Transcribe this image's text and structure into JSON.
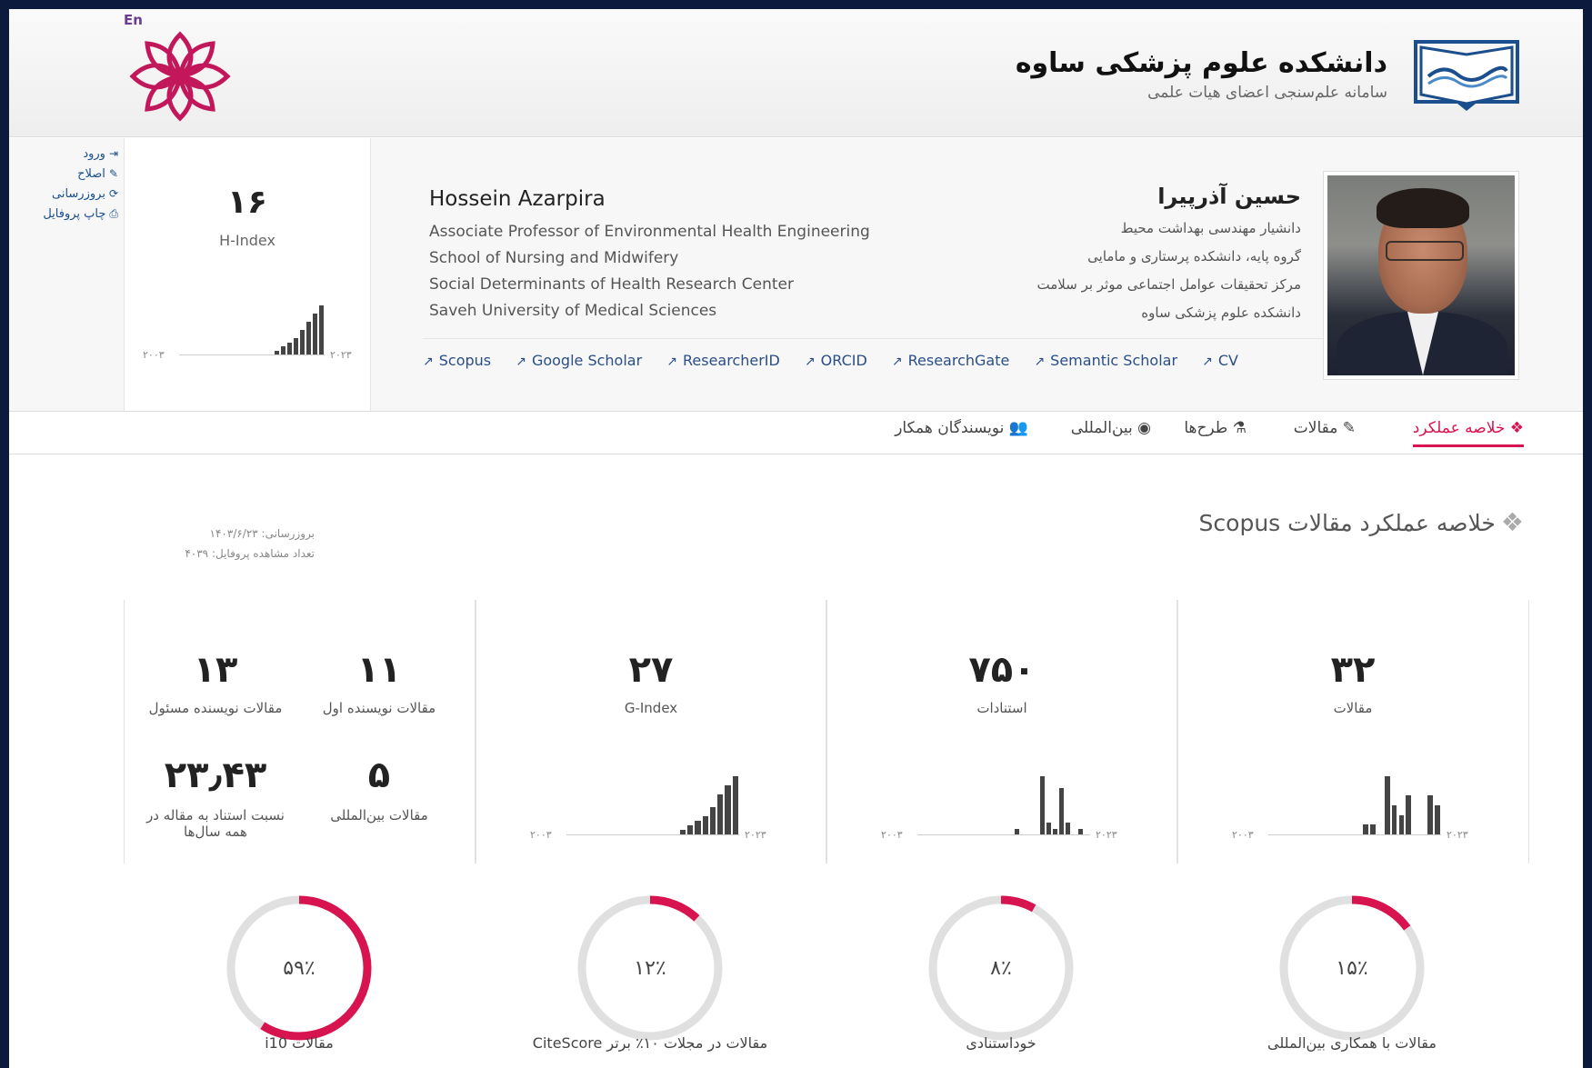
{
  "header": {
    "lang": "En",
    "uni_name": "دانشکده علوم پزشکی ساوه",
    "uni_sub": "سامانه علم‌سنجی اعضای هیات علمی"
  },
  "side_links": [
    "ورود",
    "اصلاح",
    "بروزرسانی",
    "چاپ پروفایل"
  ],
  "hindex": {
    "value": "۱۶",
    "label": "H-Index",
    "yr_start": "۲۰۰۳",
    "yr_end": "۲۰۲۳"
  },
  "profile": {
    "en_name": "Hossein Azarpira",
    "en_lines": [
      "Associate Professor of Environmental Health Engineering",
      "School of Nursing and Midwifery",
      "Social Determinants of Health Research Center",
      "Saveh University of Medical Sciences"
    ],
    "fa_name": "حسین آذرپیرا",
    "fa_lines": [
      "دانشیار مهندسی بهداشت محیط",
      "گروه پایه، دانشکده پرستاری و مامایی",
      "مرکز تحقیقات عوامل اجتماعی موثر بر سلامت",
      "دانشکده علوم پزشکی ساوه"
    ]
  },
  "ext_links": [
    "Scopus",
    "Google Scholar",
    "ResearcherID",
    "ORCID",
    "ResearchGate",
    "Semantic Scholar",
    "CV"
  ],
  "tabs": [
    "خلاصه عملکرد",
    "مقالات",
    "طرح‌ها",
    "بین‌المللی",
    "نویسندگان همکار"
  ],
  "section": {
    "title": "خلاصه عملکرد مقالات",
    "title_suffix": "Scopus",
    "updated": "بروزرسانی: ۱۴۰۳/۶/۲۳",
    "views": "تعداد مشاهده پروفایل: ۴۰۳۹"
  },
  "stats": {
    "articles": {
      "value": "۳۲",
      "label": "مقالات"
    },
    "citations": {
      "value": "۷۵۰",
      "label": "استنادات"
    },
    "gindex": {
      "value": "۲۷",
      "label": "G-Index"
    },
    "first_author": {
      "value": "۱۱",
      "label": "مقالات نویسنده اول"
    },
    "corresponding": {
      "value": "۱۳",
      "label": "مقالات نویسنده مسئول"
    },
    "international": {
      "value": "۵",
      "label": "مقالات بین‌المللی"
    },
    "ratio": {
      "value": "۲۳٫۴۳",
      "label": "نسبت استناد به مقاله در همه سال‌ها"
    },
    "yr_start": "۲۰۰۳",
    "yr_end": "۲۰۲۳"
  },
  "donuts": [
    {
      "pct_text": "۱۵٪",
      "pct": 15,
      "label": "مقالات با همکاری بین‌المللی"
    },
    {
      "pct_text": "۸٪",
      "pct": 8,
      "label": "خوداستنادی"
    },
    {
      "pct_text": "۱۲٪",
      "pct": 12,
      "label": "مقالات در مجلات ۱۰٪ برتر CiteScore"
    },
    {
      "pct_text": "۵۹٪",
      "pct": 59,
      "label": "مقالات i10"
    }
  ],
  "colors": {
    "accent": "#d7144f",
    "link": "#2a4e86",
    "ring_bg": "#e0e0e0"
  },
  "sparklines": {
    "hindex": [
      0,
      0,
      0,
      0,
      0,
      0,
      0,
      0,
      0,
      0,
      0,
      0,
      0,
      0,
      0,
      1,
      2,
      3,
      4,
      6,
      8,
      10,
      12
    ],
    "gindex": [
      0,
      0,
      0,
      0,
      0,
      0,
      0,
      0,
      0,
      0,
      0,
      0,
      0,
      0,
      0,
      1,
      2,
      3,
      4,
      6,
      9,
      11,
      13
    ],
    "citations": [
      0,
      0,
      0,
      0,
      0,
      0,
      0,
      0,
      0,
      0,
      0,
      0,
      0,
      0,
      0,
      1,
      0,
      0,
      0,
      10,
      2,
      1,
      8,
      2,
      0,
      1,
      0
    ],
    "articles": [
      0,
      0,
      0,
      0,
      0,
      0,
      0,
      0,
      0,
      0,
      0,
      0,
      0,
      1,
      1,
      0,
      6,
      3,
      2,
      4,
      0,
      0,
      4,
      3
    ]
  }
}
